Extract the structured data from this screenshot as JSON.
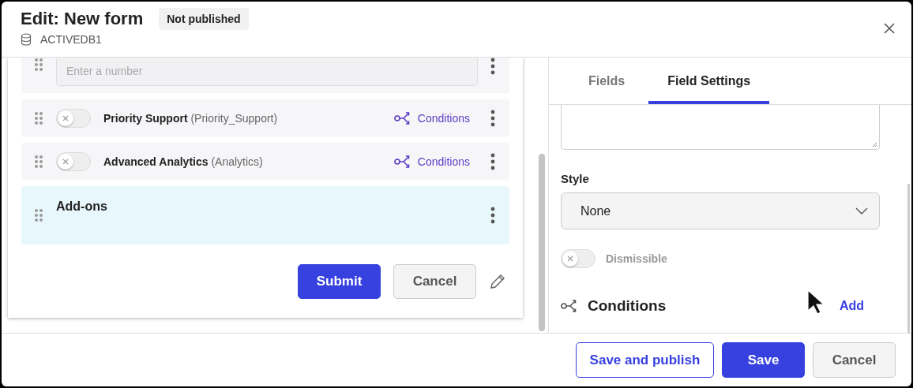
{
  "window": {
    "title": "Edit: New form",
    "status_badge": "Not published",
    "database": "ACTIVEDB1"
  },
  "form": {
    "fields": [
      {
        "kind": "number",
        "placeholder": "Enter a number",
        "selected": false
      },
      {
        "kind": "toggle",
        "label": "Priority Support",
        "key": "(Priority_Support)",
        "on": false,
        "conditions": "Conditions",
        "selected": false
      },
      {
        "kind": "toggle",
        "label": "Advanced Analytics",
        "key": "(Analytics)",
        "on": false,
        "conditions": "Conditions",
        "selected": false
      },
      {
        "kind": "section",
        "label": "Add-ons",
        "selected": true
      }
    ],
    "buttons": [
      {
        "label": "Submit",
        "kind": "primary"
      },
      {
        "label": "Cancel",
        "kind": "secondary"
      }
    ]
  },
  "tabs": [
    {
      "label": "Fields",
      "selected": false
    },
    {
      "label": "Field Settings",
      "selected": true
    }
  ],
  "settings": {
    "style_label": "Style",
    "style_value": "None",
    "dismissible": {
      "label": "Dismissible",
      "on": false
    },
    "conditions_title": "Conditions",
    "add_label": "Add"
  },
  "footer": {
    "buttons": [
      {
        "label": "Save and publish",
        "kind": "outline"
      },
      {
        "label": "Save",
        "kind": "primary"
      },
      {
        "label": "Cancel",
        "kind": "secondary"
      }
    ]
  }
}
